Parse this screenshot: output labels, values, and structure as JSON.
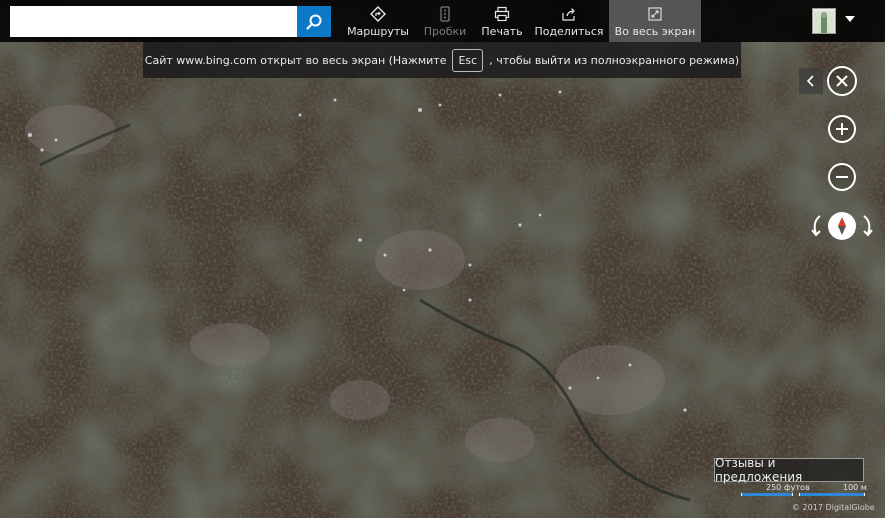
{
  "search": {
    "value": "",
    "placeholder": ""
  },
  "toolbar": {
    "items": [
      {
        "label": "Маршруты",
        "icon": "directions-icon",
        "state": "normal"
      },
      {
        "label": "Пробки",
        "icon": "traffic-icon",
        "state": "disabled"
      },
      {
        "label": "Печать",
        "icon": "print-icon",
        "state": "normal"
      },
      {
        "label": "Поделиться",
        "icon": "share-icon",
        "state": "normal"
      },
      {
        "label": "Во весь экран",
        "icon": "fullscreen-icon",
        "state": "active"
      }
    ]
  },
  "notice": {
    "text_before": "Сайт www.bing.com открыт во весь экран (Нажмите",
    "key": "Esc",
    "text_after": ", чтобы выйти из полноэкранного режима)"
  },
  "map_controls": {
    "zoom_in": "+",
    "zoom_out": "−"
  },
  "feedback": {
    "label": "Отзывы и предложения"
  },
  "scale": {
    "imperial": "250 футов",
    "metric": "100 м"
  },
  "copyright": "© 2017 DigitalGlobe",
  "colors": {
    "toolbar_bg": "#000000",
    "search_button": "#0c79c8",
    "scale_bar": "#2f88d6",
    "map_base": "#3b3128"
  }
}
